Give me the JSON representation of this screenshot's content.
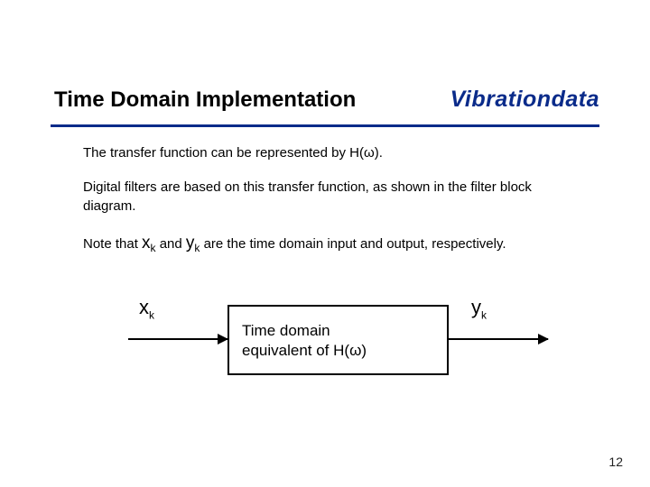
{
  "header": {
    "title": "Time Domain Implementation",
    "brand": "Vibrationdata"
  },
  "body": {
    "p1_pre": "The transfer function can be represented by H(",
    "omega": "ω",
    "p1_post": ").",
    "p2": "Digital filters are based on this transfer function, as shown in the filter block diagram.",
    "p3_pre": "Note that ",
    "x_sym": "x",
    "k_sub": "k",
    "p3_mid": " and ",
    "y_sym": "y",
    "p3_post": " are the time domain input and output, respectively."
  },
  "diagram": {
    "input_sym": "x",
    "input_sub": "k",
    "output_sym": "y",
    "output_sub": "k",
    "box_line1": "Time domain",
    "box_line2_pre": "equivalent of ",
    "box_H": "H(",
    "box_omega": "ω",
    "box_close": ")"
  },
  "pagenum": "12"
}
